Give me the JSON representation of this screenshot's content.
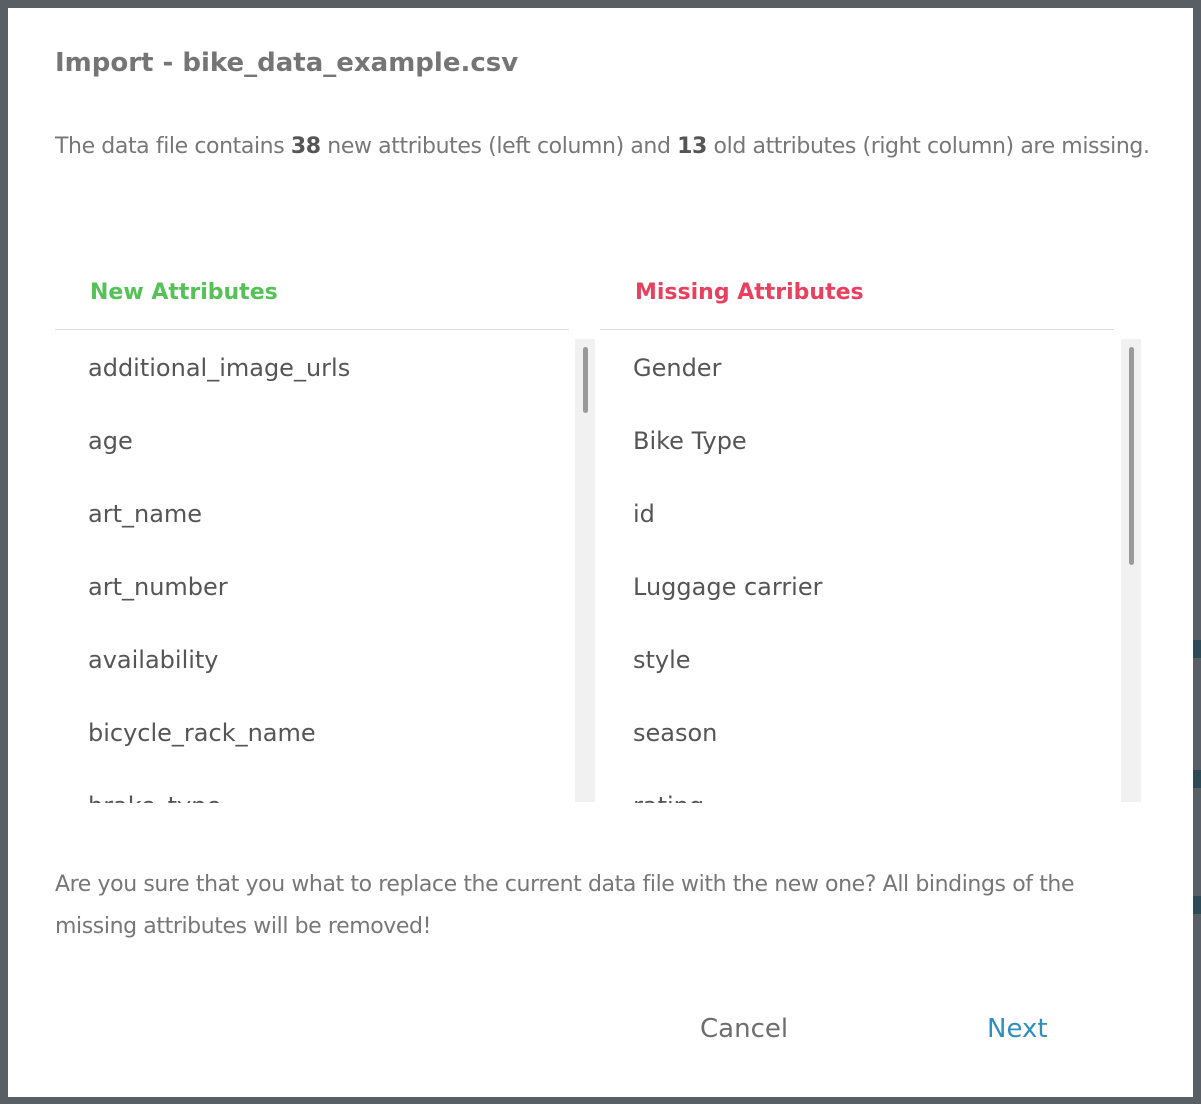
{
  "dialog": {
    "title": "Import - bike_data_example.csv",
    "intro": {
      "part1": "The data file contains ",
      "new_count": "38",
      "part2": " new attributes (left column) and ",
      "old_count": "13",
      "part3": " old attributes (right column) are missing."
    },
    "columns": {
      "new_header": "New Attributes",
      "missing_header": "Missing Attributes"
    },
    "new_attributes": [
      "additional_image_urls",
      "age",
      "art_name",
      "art_number",
      "availability",
      "bicycle_rack_name",
      "brake_type"
    ],
    "missing_attributes": [
      "Gender",
      "Bike Type",
      "id",
      "Luggage carrier",
      "style",
      "season",
      "rating"
    ],
    "confirm_text": "Are you sure that you what to replace the current data file with the new one? All bindings of the missing attributes will be removed!",
    "buttons": {
      "cancel": "Cancel",
      "next": "Next"
    },
    "colors": {
      "new_header": "#55c157",
      "missing_header": "#e8405f",
      "next_button": "#2f8fbf"
    }
  }
}
